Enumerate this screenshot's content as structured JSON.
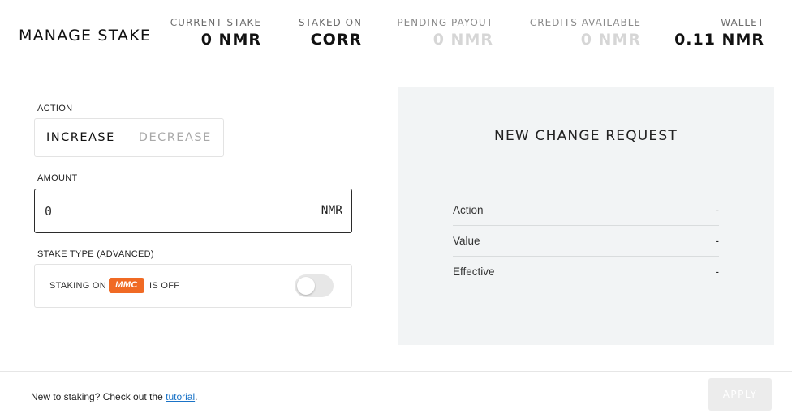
{
  "header": {
    "title": "MANAGE STAKE",
    "stats": {
      "current_stake": {
        "label": "CURRENT STAKE",
        "value": "0 NMR"
      },
      "staked_on": {
        "label": "STAKED ON",
        "value": "CORR"
      },
      "pending_payout": {
        "label": "PENDING PAYOUT",
        "value": "0 NMR"
      },
      "credits_available": {
        "label": "CREDITS AVAILABLE",
        "value": "0 NMR"
      },
      "wallet": {
        "label": "WALLET",
        "value": "0.11 NMR"
      }
    }
  },
  "form": {
    "action": {
      "label": "ACTION",
      "options": [
        "INCREASE",
        "DECREASE"
      ],
      "selected": "INCREASE"
    },
    "amount": {
      "label": "AMOUNT",
      "value": "0",
      "unit": "NMR"
    },
    "stake_type": {
      "label": "STAKE TYPE (ADVANCED)",
      "prefix": "STAKING ON",
      "badge": "MMC",
      "suffix": "IS OFF",
      "toggle_on": false
    }
  },
  "panel": {
    "title": "NEW CHANGE REQUEST",
    "rows": [
      {
        "label": "Action",
        "value": "-"
      },
      {
        "label": "Value",
        "value": "-"
      },
      {
        "label": "Effective",
        "value": "-"
      }
    ]
  },
  "footer": {
    "text": "New to staking? Check out the",
    "link": "tutorial",
    "text_end": ".",
    "apply_label": "APPLY"
  },
  "colors": {
    "accent_badge": "#f06a24",
    "link": "#1a73c7",
    "panel_bg": "#f2f4f5",
    "muted_value": "#d6d6d6"
  }
}
